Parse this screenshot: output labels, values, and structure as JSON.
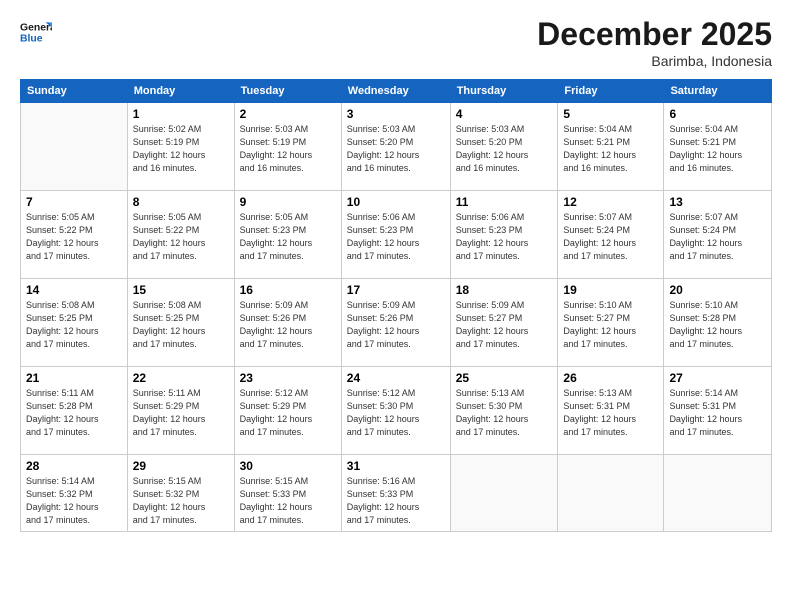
{
  "logo": {
    "line1": "General",
    "line2": "Blue"
  },
  "header": {
    "month": "December 2025",
    "location": "Barimba, Indonesia"
  },
  "weekdays": [
    "Sunday",
    "Monday",
    "Tuesday",
    "Wednesday",
    "Thursday",
    "Friday",
    "Saturday"
  ],
  "weeks": [
    [
      {
        "day": "",
        "info": ""
      },
      {
        "day": "1",
        "info": "Sunrise: 5:02 AM\nSunset: 5:19 PM\nDaylight: 12 hours\nand 16 minutes."
      },
      {
        "day": "2",
        "info": "Sunrise: 5:03 AM\nSunset: 5:19 PM\nDaylight: 12 hours\nand 16 minutes."
      },
      {
        "day": "3",
        "info": "Sunrise: 5:03 AM\nSunset: 5:20 PM\nDaylight: 12 hours\nand 16 minutes."
      },
      {
        "day": "4",
        "info": "Sunrise: 5:03 AM\nSunset: 5:20 PM\nDaylight: 12 hours\nand 16 minutes."
      },
      {
        "day": "5",
        "info": "Sunrise: 5:04 AM\nSunset: 5:21 PM\nDaylight: 12 hours\nand 16 minutes."
      },
      {
        "day": "6",
        "info": "Sunrise: 5:04 AM\nSunset: 5:21 PM\nDaylight: 12 hours\nand 16 minutes."
      }
    ],
    [
      {
        "day": "7",
        "info": ""
      },
      {
        "day": "8",
        "info": "Sunrise: 5:05 AM\nSunset: 5:22 PM\nDaylight: 12 hours\nand 17 minutes."
      },
      {
        "day": "9",
        "info": "Sunrise: 5:05 AM\nSunset: 5:23 PM\nDaylight: 12 hours\nand 17 minutes."
      },
      {
        "day": "10",
        "info": "Sunrise: 5:06 AM\nSunset: 5:23 PM\nDaylight: 12 hours\nand 17 minutes."
      },
      {
        "day": "11",
        "info": "Sunrise: 5:06 AM\nSunset: 5:23 PM\nDaylight: 12 hours\nand 17 minutes."
      },
      {
        "day": "12",
        "info": "Sunrise: 5:07 AM\nSunset: 5:24 PM\nDaylight: 12 hours\nand 17 minutes."
      },
      {
        "day": "13",
        "info": "Sunrise: 5:07 AM\nSunset: 5:24 PM\nDaylight: 12 hours\nand 17 minutes."
      }
    ],
    [
      {
        "day": "14",
        "info": ""
      },
      {
        "day": "15",
        "info": "Sunrise: 5:08 AM\nSunset: 5:25 PM\nDaylight: 12 hours\nand 17 minutes."
      },
      {
        "day": "16",
        "info": "Sunrise: 5:09 AM\nSunset: 5:26 PM\nDaylight: 12 hours\nand 17 minutes."
      },
      {
        "day": "17",
        "info": "Sunrise: 5:09 AM\nSunset: 5:26 PM\nDaylight: 12 hours\nand 17 minutes."
      },
      {
        "day": "18",
        "info": "Sunrise: 5:09 AM\nSunset: 5:27 PM\nDaylight: 12 hours\nand 17 minutes."
      },
      {
        "day": "19",
        "info": "Sunrise: 5:10 AM\nSunset: 5:27 PM\nDaylight: 12 hours\nand 17 minutes."
      },
      {
        "day": "20",
        "info": "Sunrise: 5:10 AM\nSunset: 5:28 PM\nDaylight: 12 hours\nand 17 minutes."
      }
    ],
    [
      {
        "day": "21",
        "info": ""
      },
      {
        "day": "22",
        "info": "Sunrise: 5:11 AM\nSunset: 5:29 PM\nDaylight: 12 hours\nand 17 minutes."
      },
      {
        "day": "23",
        "info": "Sunrise: 5:12 AM\nSunset: 5:29 PM\nDaylight: 12 hours\nand 17 minutes."
      },
      {
        "day": "24",
        "info": "Sunrise: 5:12 AM\nSunset: 5:30 PM\nDaylight: 12 hours\nand 17 minutes."
      },
      {
        "day": "25",
        "info": "Sunrise: 5:13 AM\nSunset: 5:30 PM\nDaylight: 12 hours\nand 17 minutes."
      },
      {
        "day": "26",
        "info": "Sunrise: 5:13 AM\nSunset: 5:31 PM\nDaylight: 12 hours\nand 17 minutes."
      },
      {
        "day": "27",
        "info": "Sunrise: 5:14 AM\nSunset: 5:31 PM\nDaylight: 12 hours\nand 17 minutes."
      }
    ],
    [
      {
        "day": "28",
        "info": "Sunrise: 5:14 AM\nSunset: 5:32 PM\nDaylight: 12 hours\nand 17 minutes."
      },
      {
        "day": "29",
        "info": "Sunrise: 5:15 AM\nSunset: 5:32 PM\nDaylight: 12 hours\nand 17 minutes."
      },
      {
        "day": "30",
        "info": "Sunrise: 5:15 AM\nSunset: 5:33 PM\nDaylight: 12 hours\nand 17 minutes."
      },
      {
        "day": "31",
        "info": "Sunrise: 5:16 AM\nSunset: 5:33 PM\nDaylight: 12 hours\nand 17 minutes."
      },
      {
        "day": "",
        "info": ""
      },
      {
        "day": "",
        "info": ""
      },
      {
        "day": "",
        "info": ""
      }
    ]
  ],
  "week1_sun_info": "Sunrise: 5:05 AM\nSunset: 5:22 PM\nDaylight: 12 hours\nand 17 minutes.",
  "week3_sun_info": "Sunrise: 5:08 AM\nSunset: 5:25 PM\nDaylight: 12 hours\nand 17 minutes.",
  "week4_sun_info": "Sunrise: 5:11 AM\nSunset: 5:28 PM\nDaylight: 12 hours\nand 17 minutes."
}
